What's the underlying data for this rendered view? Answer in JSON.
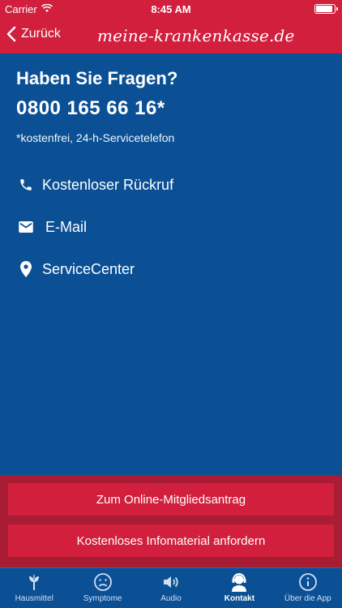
{
  "status_bar": {
    "carrier": "Carrier",
    "time": "8:45 AM"
  },
  "nav": {
    "back_label": "Zurück",
    "brand": "meine-krankenkasse.de"
  },
  "main": {
    "title": "Haben Sie Fragen?",
    "phone": "0800 165 66 16*",
    "note": "*kostenfrei, 24-h-Servicetelefon"
  },
  "contact_items": [
    {
      "label": "Kostenloser Rückruf",
      "icon": "phone-icon"
    },
    {
      "label": "E-Mail",
      "icon": "mail-icon"
    },
    {
      "label": "ServiceCenter",
      "icon": "location-pin-icon"
    }
  ],
  "actions": {
    "online_application": "Zum Online-Mitgliedsantrag",
    "info_material": "Kostenloses Infomaterial anfordern"
  },
  "tabs": [
    {
      "label": "Hausmittel",
      "icon": "herb-icon",
      "active": false
    },
    {
      "label": "Symptome",
      "icon": "sad-face-icon",
      "active": false
    },
    {
      "label": "Audio",
      "icon": "speaker-icon",
      "active": false
    },
    {
      "label": "Kontakt",
      "icon": "headset-agent-icon",
      "active": true
    },
    {
      "label": "Über die App",
      "icon": "info-icon",
      "active": false
    }
  ],
  "colors": {
    "brand_red": "#d11f3d",
    "dark_red": "#a81d33",
    "brand_blue": "#0b4f95"
  }
}
